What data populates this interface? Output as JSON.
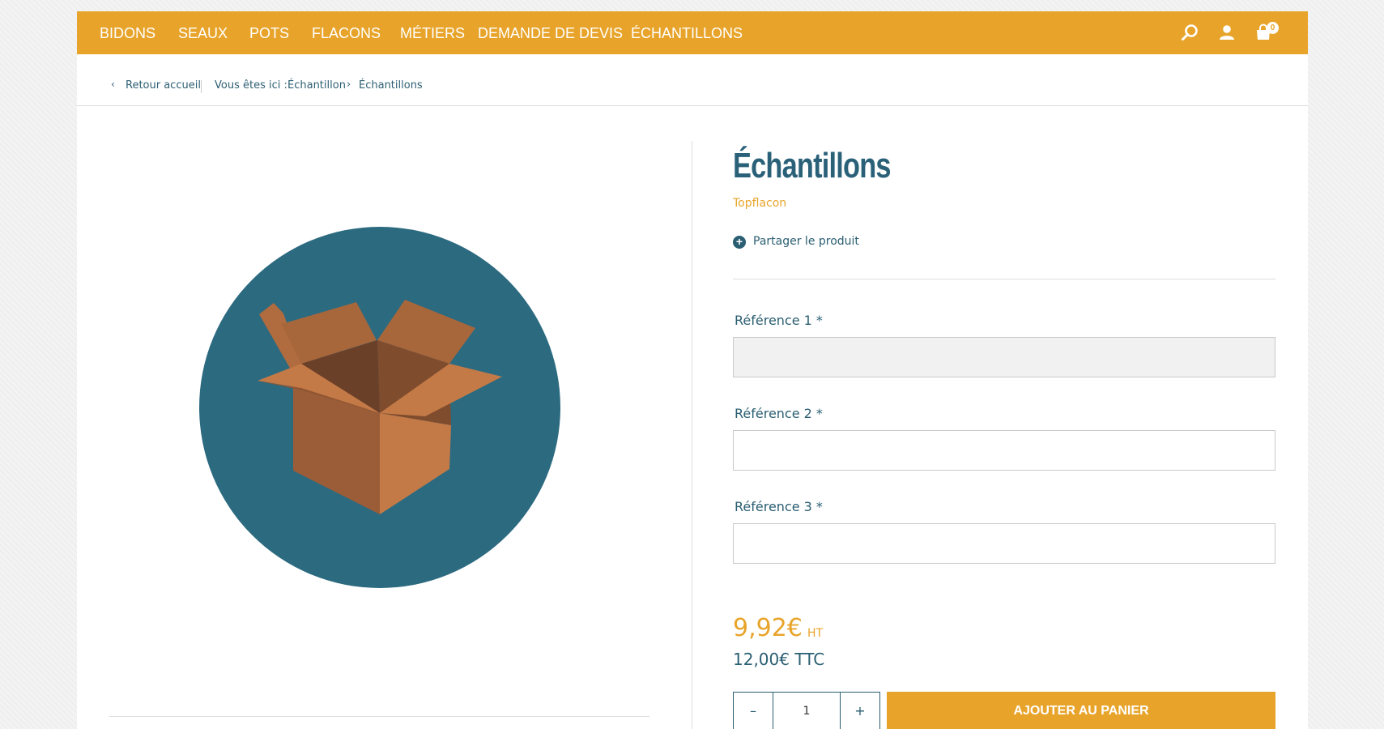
{
  "nav": {
    "items": [
      {
        "label": "BIDONS"
      },
      {
        "label": "SEAUX"
      },
      {
        "label": "POTS"
      },
      {
        "label": "FLACONS"
      },
      {
        "label": "MÉTIERS"
      },
      {
        "label": "DEMANDE DE DEVIS"
      },
      {
        "label": "ÉCHANTILLONS"
      }
    ],
    "icons": [
      "search-icon",
      "user-icon",
      "shopping-bag-icon"
    ],
    "cart_count": "0"
  },
  "breadcrumb": {
    "back_label": "Retour accueil",
    "here_label": "Vous êtes ici :",
    "items": [
      "Échantillon",
      "Échantillons"
    ]
  },
  "product": {
    "title": "Échantillons",
    "brand": "Topflacon",
    "share_label": "Partager le produit",
    "fields": [
      {
        "label": "Référence 1 *",
        "value": ""
      },
      {
        "label": "Référence 2 *",
        "value": ""
      },
      {
        "label": "Référence 3 *",
        "value": ""
      }
    ],
    "price_ht": "9,92€",
    "price_ht_suffix": "HT",
    "price_ttc": "12,00€ TTC",
    "quantity": "1",
    "minus_label": "–",
    "plus_label": "+",
    "add_to_cart_label": "AJOUTER AU PANIER"
  },
  "colors": {
    "accent": "#e8a42a",
    "primary": "#2a6178",
    "image_circle": "#2c6a80",
    "box": "#c47a46"
  }
}
